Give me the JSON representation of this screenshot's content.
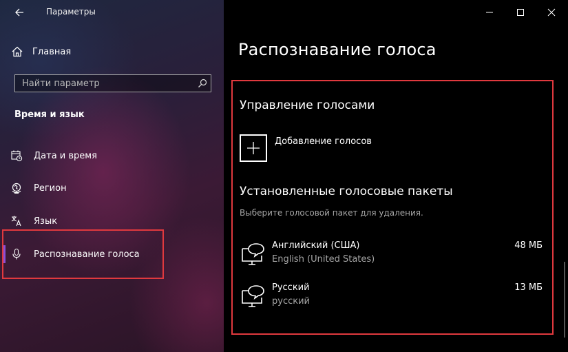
{
  "window": {
    "title": "Параметры",
    "controls": {
      "minimize": "minimize-icon",
      "maximize": "maximize-icon",
      "close": "close-icon"
    }
  },
  "sidebar": {
    "home_label": "Главная",
    "search_placeholder": "Найти параметр",
    "section_title": "Время и язык",
    "items": [
      {
        "label": "Дата и время",
        "icon": "calendar-clock-icon",
        "active": false
      },
      {
        "label": "Регион",
        "icon": "globe-icon",
        "active": false
      },
      {
        "label": "Язык",
        "icon": "language-icon",
        "active": false
      },
      {
        "label": "Распознавание голоса",
        "icon": "microphone-icon",
        "active": true
      }
    ]
  },
  "main": {
    "page_title": "Распознавание голоса",
    "manage_heading": "Управление голосами",
    "add_voices_label": "Добавление голосов",
    "installed_heading": "Установленные голосовые пакеты",
    "installed_hint": "Выберите голосовой пакет для удаления.",
    "packs": [
      {
        "name": "Английский (США)",
        "sub": "English (United States)",
        "size": "48 МБ",
        "icon": "speech-pc-icon"
      },
      {
        "name": "Русский",
        "sub": "русский",
        "size": "13 МБ",
        "icon": "speech-pc-icon"
      }
    ]
  },
  "colors": {
    "highlight": "#e0393e",
    "accent": "#8a4fd8"
  }
}
